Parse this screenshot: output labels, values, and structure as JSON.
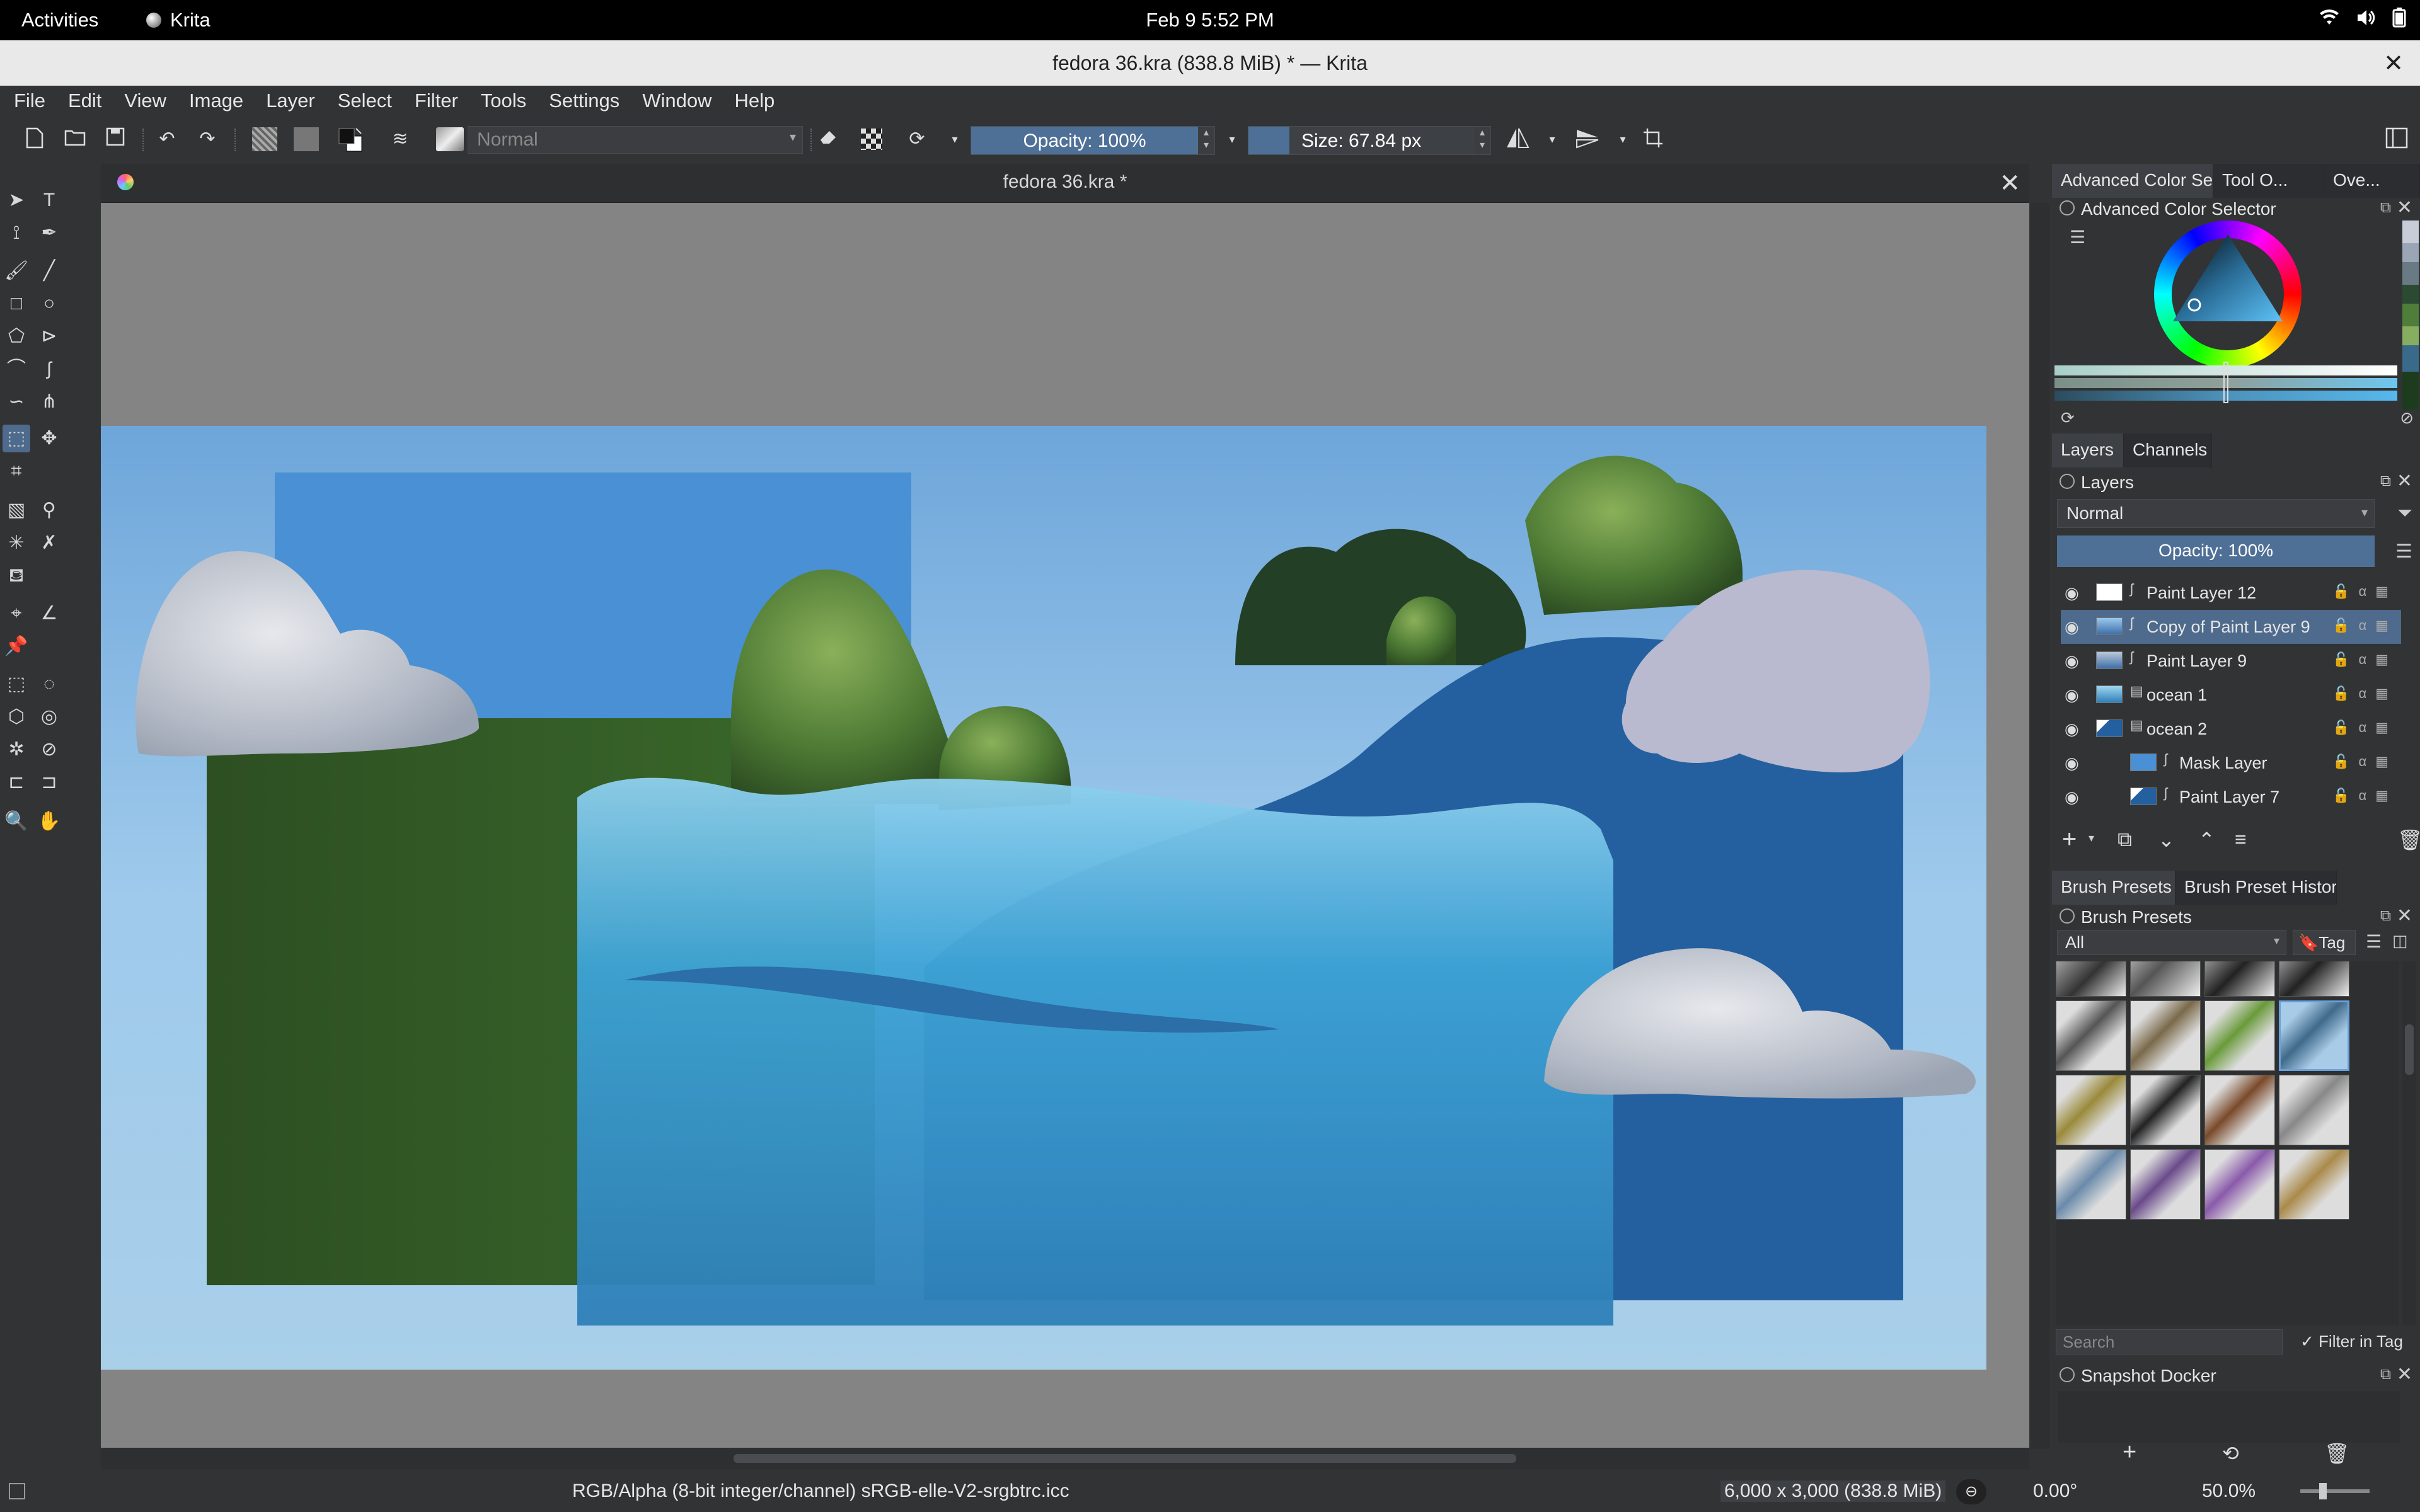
{
  "topbar": {
    "activities": "Activities",
    "app_name": "Krita",
    "clock": "Feb 9  5:52 PM",
    "icons": [
      "wifi-icon",
      "volume-icon",
      "battery-icon"
    ]
  },
  "window": {
    "title": "fedora 36.kra (838.8 MiB)  * — Krita",
    "close_glyph": "✕"
  },
  "menubar": [
    "File",
    "Edit",
    "View",
    "Image",
    "Layer",
    "Select",
    "Filter",
    "Tools",
    "Settings",
    "Window",
    "Help"
  ],
  "toolbar": {
    "blend_mode": "Normal",
    "opacity_label": "Opacity: 100%",
    "opacity_value": 1.0,
    "size_prefix": "Size:",
    "size_value_text": "67.84 px",
    "size_fill_fraction": 0.17
  },
  "document": {
    "tab_title": "fedora 36.kra *",
    "close_glyph": "✕"
  },
  "dock": {
    "top_tabs": [
      "Advanced Color Se...",
      "Tool O...",
      "Ove..."
    ],
    "color_selector_title": "Advanced Color Selector",
    "layers_tabs": [
      "Layers",
      "Channels"
    ],
    "layers_title": "Layers",
    "layers_blend": "Normal",
    "layers_opacity": "Opacity:  100%",
    "layers": [
      {
        "name": "Paint Layer 12",
        "selected": false
      },
      {
        "name": "Copy of Paint Layer 9",
        "selected": true
      },
      {
        "name": "Paint Layer 9",
        "selected": false
      },
      {
        "name": "ocean 1",
        "selected": false
      },
      {
        "name": "ocean 2",
        "selected": false
      },
      {
        "name": "Mask Layer",
        "selected": false
      },
      {
        "name": "Paint Layer 7",
        "selected": false
      }
    ],
    "brush_tabs": [
      "Brush Presets",
      "Brush Preset History"
    ],
    "brush_title": "Brush Presets",
    "brush_filter": "All",
    "brush_tag": "Tag",
    "brush_search_placeholder": "Search",
    "filter_in_tag": "Filter in Tag",
    "snapshot_title": "Snapshot Docker"
  },
  "statusbar": {
    "color_info": "RGB/Alpha (8-bit integer/channel)  sRGB-elle-V2-srgbtrc.icc",
    "dimensions": "6,000 x 3,000 (838.8 MiB)",
    "rotation": "0.00°",
    "zoom": "50.0%"
  },
  "colors": {
    "accent": "#4e6a8c",
    "sky": "#8fc0e8",
    "hill_green": "#2f5226",
    "ocean_blue": "#2563a6",
    "cloud_lilac": "#b9b9cf"
  }
}
